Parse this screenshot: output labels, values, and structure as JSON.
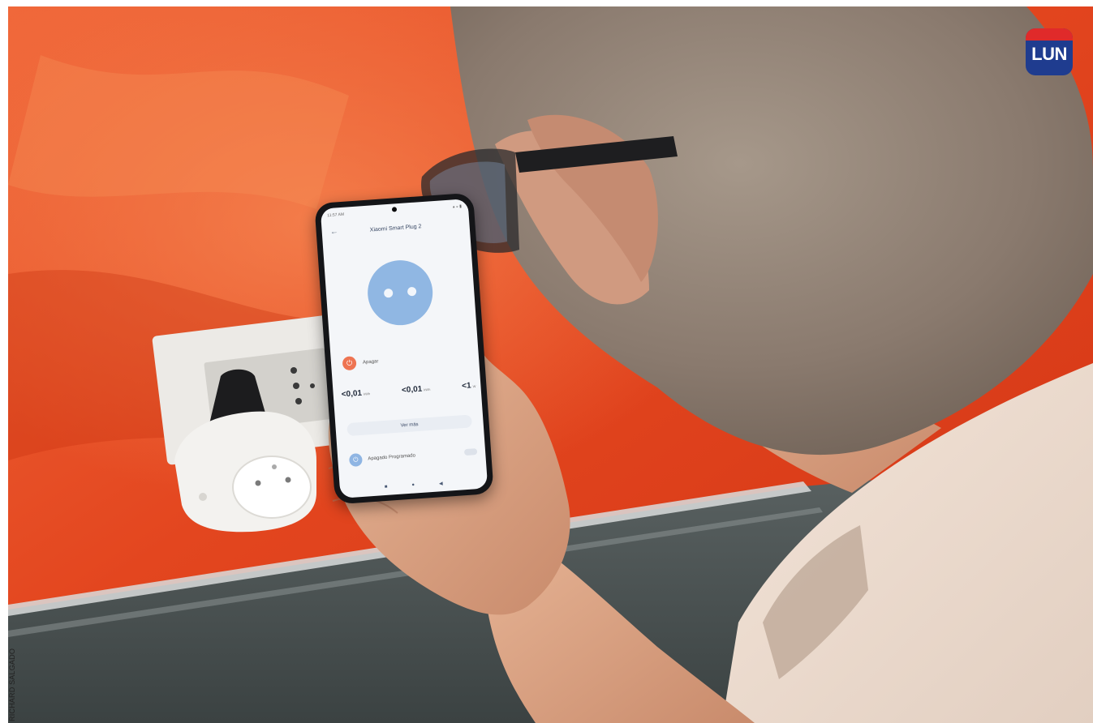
{
  "photo_credit": "RICHARD SALGADO",
  "logo": {
    "text": "LUN"
  },
  "phone": {
    "status_time": "11:57 AM",
    "app_title": "Xiaomi Smart Plug 2",
    "power_label": "Apagar",
    "stats": [
      {
        "value": "<0,01",
        "unit": "kWh"
      },
      {
        "value": "<0,01",
        "unit": "kWh"
      },
      {
        "value": "<1",
        "unit": "W"
      }
    ],
    "more_button": "Ver más",
    "schedule_label": "Apagado Programado"
  },
  "icons": {
    "back": "arrow-left",
    "power": "power",
    "schedule": "power",
    "logo": "lun-logo"
  },
  "colors": {
    "wall": "#e2461f",
    "skirting": "#4a5252",
    "plug_accent": "#90b7e3",
    "power_button": "#ee7452"
  }
}
